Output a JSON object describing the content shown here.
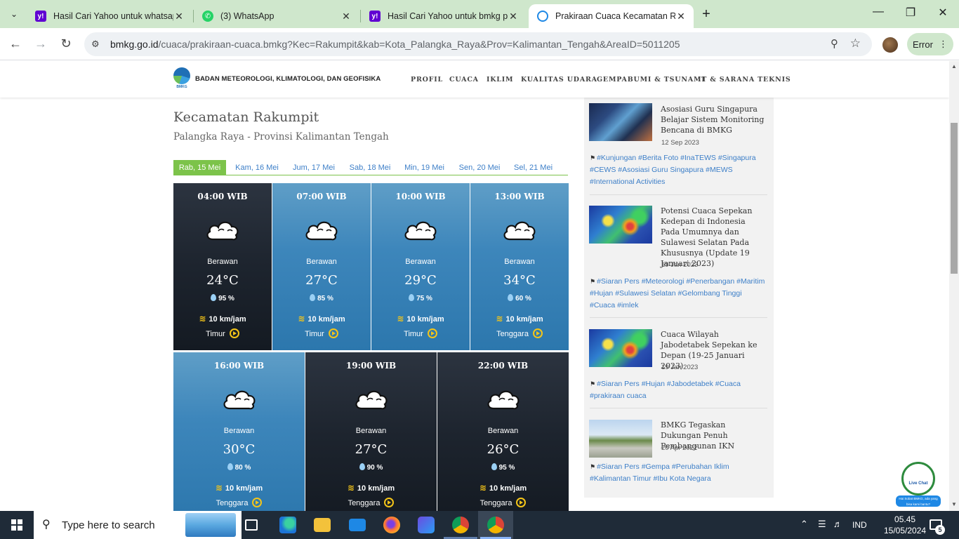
{
  "browser": {
    "tabs": [
      {
        "title": "Hasil Cari Yahoo untuk whatsapp",
        "favicon": "yahoo-icon",
        "active": false
      },
      {
        "title": "(3) WhatsApp",
        "favicon": "whatsapp-icon",
        "active": false
      },
      {
        "title": "Hasil Cari Yahoo untuk bmkg pa",
        "favicon": "yahoo-icon",
        "active": false
      },
      {
        "title": "Prakiraan Cuaca Kecamatan Rak",
        "favicon": "bmkg-icon",
        "active": true
      }
    ],
    "url_host": "bmkg.go.id",
    "url_path": "/cuaca/prakiraan-cuaca.bmkg?Kec=Rakumpit&kab=Kota_Palangka_Raya&Prov=Kalimantan_Tengah&AreaID=5011205",
    "error_label": "Error"
  },
  "site": {
    "org_name": "BADAN METEOROLOGI, KLIMATOLOGI, DAN GEOFISIKA",
    "logo_text": "BMKG",
    "menu": [
      "PROFIL",
      "CUACA",
      "IKLIM",
      "KUALITAS UDARA",
      "GEMPABUMI & TSUNAMI",
      "IT & SARANA TEKNIS"
    ]
  },
  "location": {
    "title": "Kecamatan Rakumpit",
    "subtitle": "Palangka Raya - Provinsi Kalimantan Tengah"
  },
  "day_tabs": [
    "Rab, 15 Mei",
    "Kam, 16 Mei",
    "Jum, 17 Mei",
    "Sab, 18 Mei",
    "Min, 19 Mei",
    "Sen, 20 Mei",
    "Sel, 21 Mei"
  ],
  "forecast": [
    {
      "time": "04:00 WIB",
      "cond": "Berawan",
      "temp": "24°C",
      "hum": "95 %",
      "wind": "10 km/jam",
      "dir": "Timur",
      "theme": "dark"
    },
    {
      "time": "07:00 WIB",
      "cond": "Berawan",
      "temp": "27°C",
      "hum": "85 %",
      "wind": "10 km/jam",
      "dir": "Timur",
      "theme": "light"
    },
    {
      "time": "10:00 WIB",
      "cond": "Berawan",
      "temp": "29°C",
      "hum": "75 %",
      "wind": "10 km/jam",
      "dir": "Timur",
      "theme": "light"
    },
    {
      "time": "13:00 WIB",
      "cond": "Berawan",
      "temp": "34°C",
      "hum": "60 %",
      "wind": "10 km/jam",
      "dir": "Tenggara",
      "theme": "light"
    },
    {
      "time": "16:00 WIB",
      "cond": "Berawan",
      "temp": "30°C",
      "hum": "80 %",
      "wind": "10 km/jam",
      "dir": "Tenggara",
      "theme": "light"
    },
    {
      "time": "19:00 WIB",
      "cond": "Berawan",
      "temp": "27°C",
      "hum": "90 %",
      "wind": "10 km/jam",
      "dir": "Tenggara",
      "theme": "dark"
    },
    {
      "time": "22:00 WIB",
      "cond": "Berawan",
      "temp": "26°C",
      "hum": "95 %",
      "wind": "10 km/jam",
      "dir": "Tenggara",
      "theme": "dark"
    }
  ],
  "news": [
    {
      "title": "Asosiasi Guru Singapura Belajar Sistem Monitoring Bencana di BMKG",
      "date": "12 Sep 2023",
      "tags": "#Kunjungan #Berita Foto #InaTEWS #Singapura #CEWS #Asosiasi Guru Singapura #MEWS #International Activities"
    },
    {
      "title": "Potensi Cuaca Sepekan Kedepan di Indonesia Pada Umumnya dan Sulawesi Selatan Pada Khususnya (Update 19 Januari 2023)",
      "date": "19 Jan 2023",
      "tags": "#Siaran Pers #Meteorologi #Penerbangan #Maritim #Hujan #Sulawesi Selatan #Gelombang Tinggi #Cuaca #imlek"
    },
    {
      "title": "Cuaca Wilayah Jabodetabek Sepekan ke Depan (19-25 Januari 2023)",
      "date": "19 Jan 2023",
      "tags": "#Siaran Pers #Hujan #Jabodetabek #Cuaca #prakiraan cuaca"
    },
    {
      "title": "BMKG Tegaskan Dukungan Penuh Pembangunan IKN",
      "date": "20 Apr 2022",
      "tags": "#Siaran Pers #Gempa #Perubahan Iklim #Kalimantan Timur #Ibu Kota Negara"
    }
  ],
  "livechat": {
    "label": "Live Chat",
    "bubble": "Hai Sobat BMKG, ada yang bisa kami bantu?"
  },
  "taskbar": {
    "search_placeholder": "Type here to search",
    "lang": "IND",
    "time": "05.45",
    "date": "15/05/2024",
    "notif_count": "5"
  }
}
